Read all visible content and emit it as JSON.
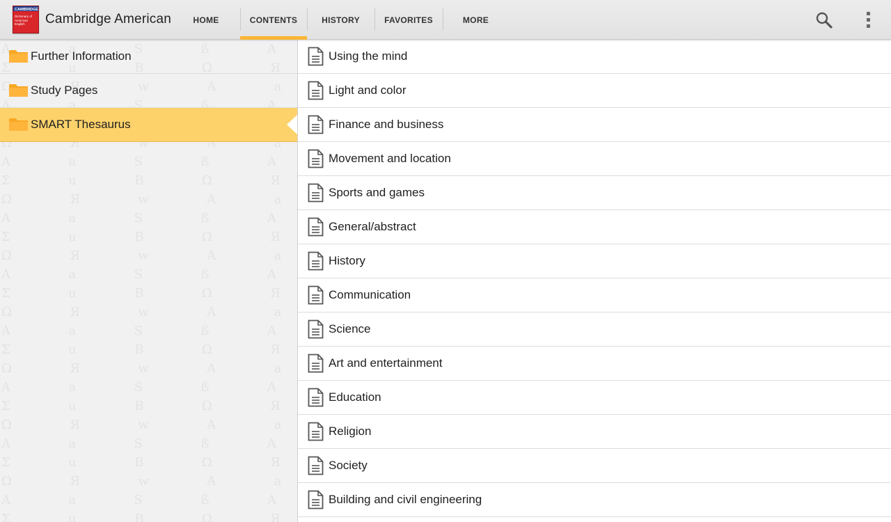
{
  "app": {
    "title": "Cambridge American",
    "logo_text": "CAMBRIDGE",
    "logo_subtext": "Dictionary of American English"
  },
  "tabs": [
    {
      "label": "HOME",
      "active": false
    },
    {
      "label": "CONTENTS",
      "active": true
    },
    {
      "label": "HISTORY",
      "active": false
    },
    {
      "label": "FAVORITES",
      "active": false
    },
    {
      "label": "MORE",
      "active": false
    }
  ],
  "actions": {
    "search_icon": "search-icon",
    "overflow_icon": "overflow-menu-icon"
  },
  "colors": {
    "accent": "#fbb534",
    "selected_row": "#fdd26b",
    "folder": "#f9a825"
  },
  "folders": [
    {
      "label": "Further Information",
      "selected": false
    },
    {
      "label": "Study Pages",
      "selected": false
    },
    {
      "label": "SMART Thesaurus",
      "selected": true
    }
  ],
  "topics": [
    "Using the mind",
    "Light and color",
    "Finance and business",
    "Movement and location",
    "Sports and games",
    "General/abstract",
    "History",
    "Communication",
    "Science",
    "Art and entertainment",
    "Education",
    "Religion",
    "Society",
    "Building and civil engineering"
  ]
}
